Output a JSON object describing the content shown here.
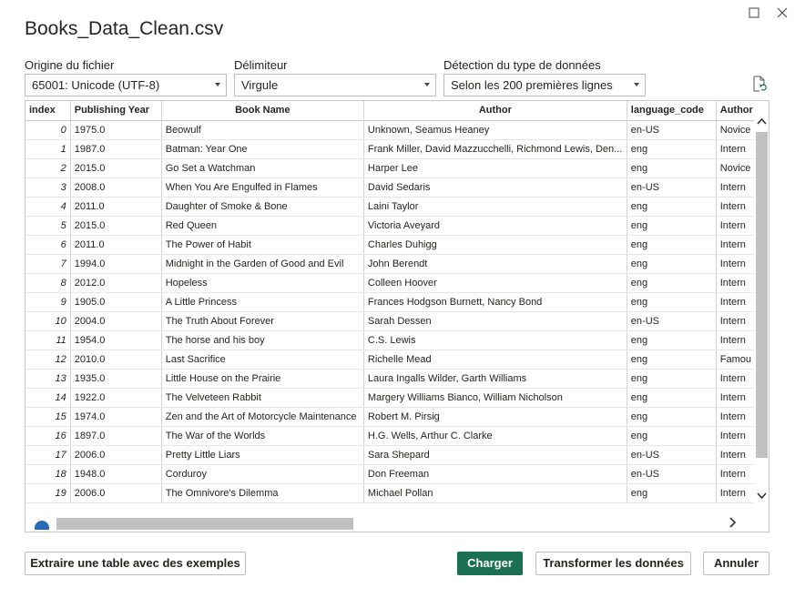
{
  "window": {
    "title": "Books_Data_Clean.csv"
  },
  "origin": {
    "label": "Origine du fichier",
    "value": "65001: Unicode (UTF-8)"
  },
  "delimiter": {
    "label": "Délimiteur",
    "value": "Virgule"
  },
  "detection": {
    "label": "Détection du type de données",
    "value": "Selon les 200 premières lignes"
  },
  "grid": {
    "columns": [
      "index",
      "Publishing Year",
      "Book Name",
      "Author",
      "language_code",
      "Author"
    ],
    "rows": [
      [
        "0",
        "1975.0",
        "Beowulf",
        "Unknown, Seamus Heaney",
        "en-US",
        "Novice"
      ],
      [
        "1",
        "1987.0",
        "Batman: Year One",
        "Frank Miller, David Mazzucchelli, Richmond Lewis, Den...",
        "eng",
        "Intern"
      ],
      [
        "2",
        "2015.0",
        "Go Set a Watchman",
        "Harper Lee",
        "eng",
        "Novice"
      ],
      [
        "3",
        "2008.0",
        "When You Are Engulfed in Flames",
        "David Sedaris",
        "en-US",
        "Intern"
      ],
      [
        "4",
        "2011.0",
        "Daughter of Smoke & Bone",
        "Laini Taylor",
        "eng",
        "Intern"
      ],
      [
        "5",
        "2015.0",
        "Red Queen",
        "Victoria Aveyard",
        "eng",
        "Intern"
      ],
      [
        "6",
        "2011.0",
        "The Power of Habit",
        "Charles Duhigg",
        "eng",
        "Intern"
      ],
      [
        "7",
        "1994.0",
        "Midnight in the Garden of Good and Evil",
        "John Berendt",
        "eng",
        "Intern"
      ],
      [
        "8",
        "2012.0",
        "Hopeless",
        "Colleen Hoover",
        "eng",
        "Intern"
      ],
      [
        "9",
        "1905.0",
        "A Little Princess",
        "Frances Hodgson Burnett, Nancy Bond",
        "eng",
        "Intern"
      ],
      [
        "10",
        "2004.0",
        "The Truth About Forever",
        "Sarah Dessen",
        "en-US",
        "Intern"
      ],
      [
        "11",
        "1954.0",
        "The horse and his boy",
        "C.S. Lewis",
        "eng",
        "Intern"
      ],
      [
        "12",
        "2010.0",
        "Last Sacrifice",
        "Richelle Mead",
        "eng",
        "Famou"
      ],
      [
        "13",
        "1935.0",
        "Little House on the Prairie",
        "Laura Ingalls Wilder, Garth Williams",
        "eng",
        "Intern"
      ],
      [
        "14",
        "1922.0",
        "The Velveteen Rabbit",
        "Margery Williams Bianco, William Nicholson",
        "eng",
        "Intern"
      ],
      [
        "15",
        "1974.0",
        "Zen and the Art of Motorcycle Maintenance",
        "Robert M. Pirsig",
        "eng",
        "Intern"
      ],
      [
        "16",
        "1897.0",
        "The War of the Worlds",
        "H.G. Wells, Arthur C. Clarke",
        "eng",
        "Intern"
      ],
      [
        "17",
        "2006.0",
        "Pretty Little Liars",
        "Sara Shepard",
        "en-US",
        "Intern"
      ],
      [
        "18",
        "1948.0",
        "Corduroy",
        "Don Freeman",
        "en-US",
        "Intern"
      ],
      [
        "19",
        "2006.0",
        "The Omnivore's Dilemma",
        "Michael Pollan",
        "eng",
        "Intern"
      ]
    ]
  },
  "buttons": {
    "extract": "Extraire une table avec des exemples",
    "load": "Charger",
    "transform": "Transformer les données",
    "cancel": "Annuler"
  },
  "colors": {
    "primary": "#1b6f52"
  },
  "icons": [
    "maximize-icon",
    "close-icon",
    "refresh-icon",
    "chevron-down-icon",
    "chevron-up-icon",
    "chevron-right-icon",
    "help-icon"
  ]
}
